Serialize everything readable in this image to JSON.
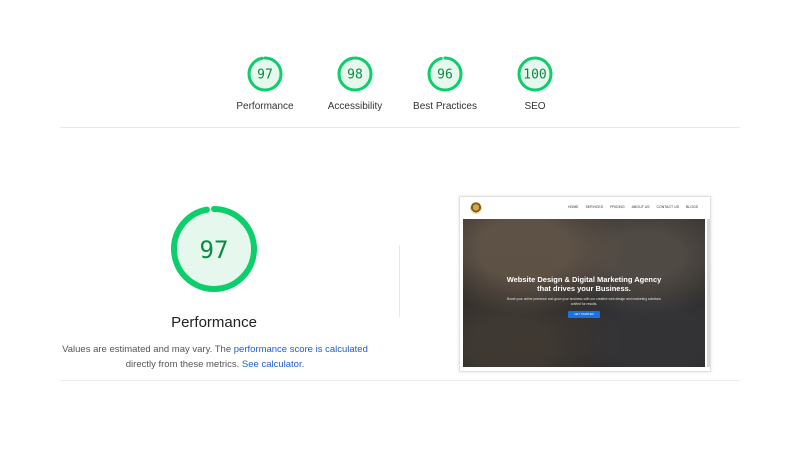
{
  "gauges": [
    {
      "score": 97,
      "label": "Performance"
    },
    {
      "score": 98,
      "label": "Accessibility"
    },
    {
      "score": 96,
      "label": "Best Practices"
    },
    {
      "score": 100,
      "label": "SEO"
    }
  ],
  "main": {
    "score": 97,
    "title": "Performance",
    "desc_prefix": "Values are estimated and may vary. The ",
    "desc_link1": "performance score is calculated",
    "desc_middle": " directly from these metrics. ",
    "desc_link2": "See calculator."
  },
  "preview": {
    "menu": [
      "HOME",
      "SERVICES",
      "PRICING",
      "ABOUT US",
      "CONTACT US",
      "BLOGS"
    ],
    "hero_line1": "Website Design & Digital Marketing Agency",
    "hero_line2": "that drives your Business.",
    "hero_text": "Boost your online presence and grow your business with our creative web design and marketing solutions crafted for results.",
    "cta": "GET STARTED"
  },
  "colors": {
    "pass_green": "#0cce6b",
    "pass_text": "#0c8a45",
    "pass_fill": "#e6f8ee",
    "link_blue": "#1a5fd6"
  }
}
